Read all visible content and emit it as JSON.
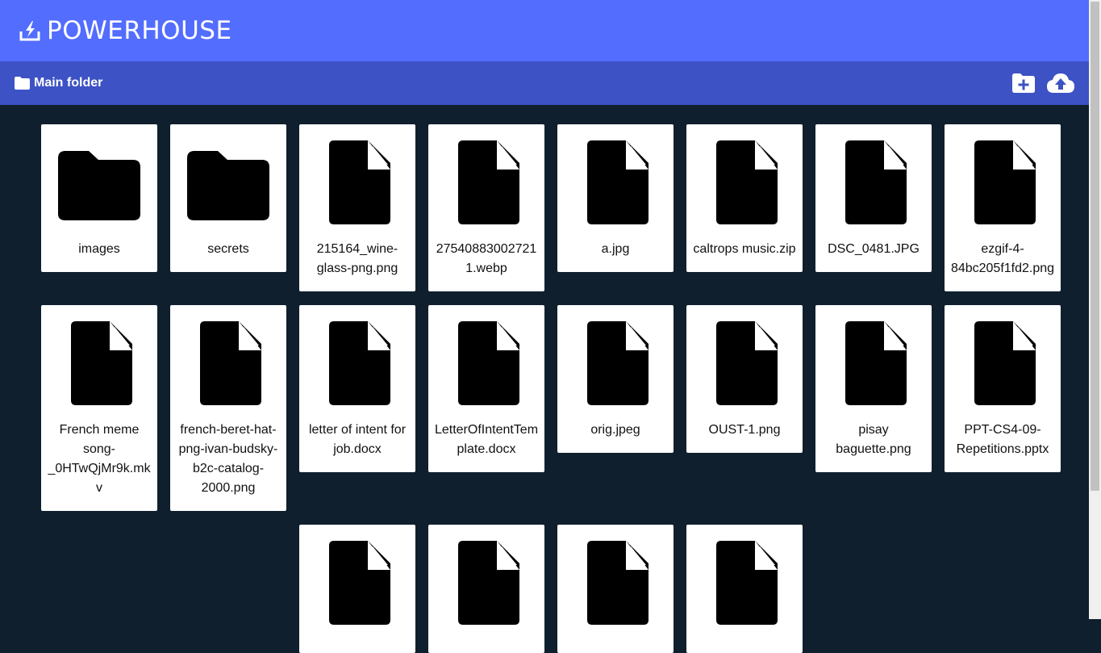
{
  "app": {
    "brand": "POWERHOUSE",
    "brand_icon": "lightning-download-icon"
  },
  "path_bar": {
    "current_folder": "Main folder",
    "folder_icon": "folder-icon",
    "actions": {
      "new_folder_icon": "folder-plus-icon",
      "upload_icon": "cloud-upload-icon"
    }
  },
  "colors": {
    "brand_bar": "#536dfe",
    "path_bar": "#3d52c4",
    "background": "#0f1f2e",
    "card": "#ffffff"
  },
  "items": [
    {
      "name": "images",
      "type": "folder"
    },
    {
      "name": "secrets",
      "type": "folder"
    },
    {
      "name": "215164_wine-glass-png.png",
      "type": "file"
    },
    {
      "name": "275408830027211.webp",
      "type": "file"
    },
    {
      "name": "a.jpg",
      "type": "file"
    },
    {
      "name": "caltrops music.zip",
      "type": "file"
    },
    {
      "name": "DSC_0481.JPG",
      "type": "file"
    },
    {
      "name": "ezgif-4-84bc205f1fd2.png",
      "type": "file"
    },
    {
      "name": "French meme song-_0HTwQjMr9k.mkv",
      "type": "file"
    },
    {
      "name": "french-beret-hat-png-ivan-budsky-b2c-catalog-2000.png",
      "type": "file"
    },
    {
      "name": "letter of intent for job.docx",
      "type": "file"
    },
    {
      "name": "LetterOfIntentTemplate.docx",
      "type": "file"
    },
    {
      "name": "orig.jpeg",
      "type": "file"
    },
    {
      "name": "OUST-1.png",
      "type": "file"
    },
    {
      "name": "pisay baguette.png",
      "type": "file"
    },
    {
      "name": "PPT-CS4-09-Repetitions.pptx",
      "type": "file"
    },
    {
      "name": "",
      "type": "file"
    },
    {
      "name": "",
      "type": "file"
    },
    {
      "name": "",
      "type": "file"
    },
    {
      "name": "",
      "type": "file"
    }
  ]
}
